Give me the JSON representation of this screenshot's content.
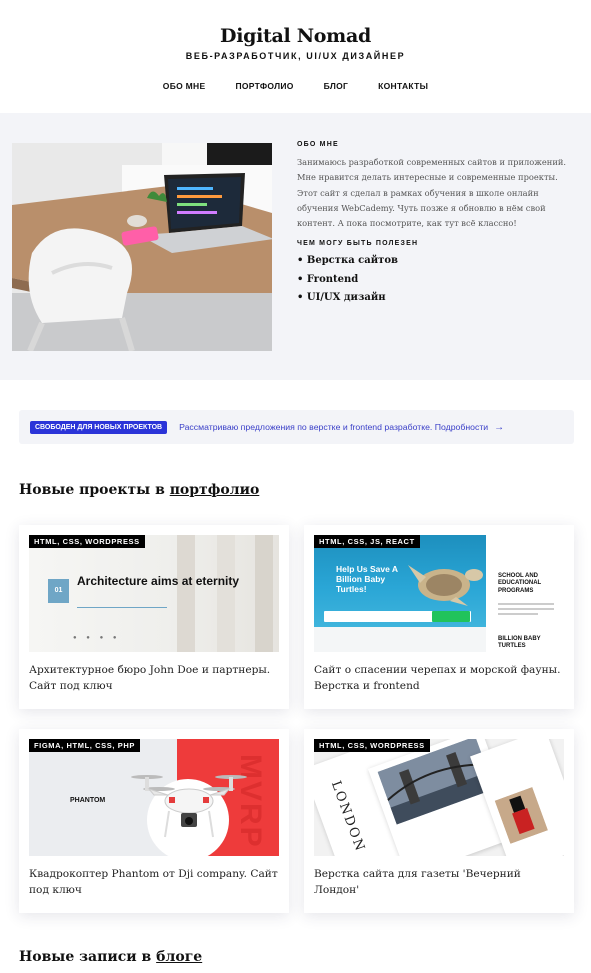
{
  "header": {
    "title": "Digital Nomad",
    "subtitle": "ВЕБ-РАЗРАБОТЧИК, UI/UX ДИЗАЙНЕР",
    "nav": [
      "ОБО МНЕ",
      "ПОРТФОЛИО",
      "БЛОГ",
      "КОНТАКТЫ"
    ]
  },
  "about": {
    "heading": "ОБО МНЕ",
    "text": "Занимаюсь разработкой современных сайтов и приложений. Мне нравится делать интересные и современные проекты. Этот сайт я сделал в рамках обучения в школе онлайн обучения WebCademy. Чуть позже я обновлю в нём свой контент. А пока посмотрите, как тут всё классно!",
    "skills_heading": "ЧЕМ МОГУ БЫТЬ ПОЛЕЗЕН",
    "skills": [
      "Верстка сайтов",
      "Frontend",
      "UI/UX дизайн"
    ]
  },
  "banner": {
    "badge": "СВОБОДЕН ДЛЯ НОВЫХ ПРОЕКТОВ",
    "text": "Рассматриваю предложения по верстке и frontend разработке. Подробности",
    "arrow": "→"
  },
  "portfolio": {
    "heading_prefix": "Новые проекты в",
    "heading_link": "портфолио",
    "cards": [
      {
        "tag": "HTML, CSS, WORDPRESS",
        "title": "Архитектурное бюро John Doe и партнеры. Сайт под ключ",
        "art_number": "01",
        "art_text": "Architecture aims at eternity"
      },
      {
        "tag": "HTML, CSS, JS, REACT",
        "title": "Сайт о спасении черепах и морской фауны. Верстка и frontend",
        "art_heading": "Help Us Save A Billion Baby Turtles!",
        "art_side_1": "SCHOOL AND EDUCATIONAL PROGRAMS",
        "art_side_2": "BILLION BABY TURTLES"
      },
      {
        "tag": "FIGMA, HTML, CSS, PHP",
        "title": "Квадрокоптер Phantom от Dji company. Сайт под ключ",
        "art_label": "PHANTOM",
        "art_vertical": "MVRP"
      },
      {
        "tag": "HTML, CSS, WORDPRESS",
        "title": "Верстка сайта для газеты 'Вечерний Лондон'",
        "art_title": "LONDON"
      }
    ]
  },
  "blog": {
    "heading_prefix": "Новые записи в",
    "heading_link": "блоге"
  }
}
